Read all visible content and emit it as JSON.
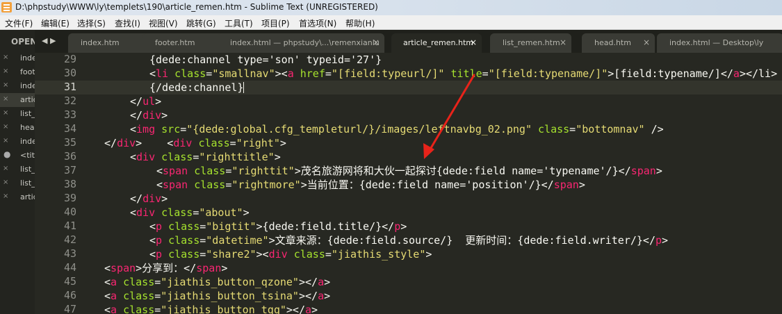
{
  "window": {
    "title": "D:\\phpstudy\\WWW\\ly\\templets\\190\\article_remen.htm - Sublime Text (UNREGISTERED)"
  },
  "menubar": [
    {
      "id": "file",
      "label": "文件(F)"
    },
    {
      "id": "edit",
      "label": "编辑(E)"
    },
    {
      "id": "selection",
      "label": "选择(S)"
    },
    {
      "id": "find",
      "label": "查找(I)"
    },
    {
      "id": "view",
      "label": "视图(V)"
    },
    {
      "id": "goto",
      "label": "跳转(G)"
    },
    {
      "id": "tools",
      "label": "工具(T)"
    },
    {
      "id": "project",
      "label": "项目(P)"
    },
    {
      "id": "preferences",
      "label": "首选项(N)"
    },
    {
      "id": "help",
      "label": "帮助(H)"
    }
  ],
  "sidebar": {
    "header": "OPEN",
    "files": [
      {
        "label": "inde",
        "marker": "×",
        "active": false
      },
      {
        "label": "foot",
        "marker": "×",
        "active": false
      },
      {
        "label": "inde",
        "marker": "×",
        "active": false
      },
      {
        "label": "artic",
        "marker": "×",
        "active": true
      },
      {
        "label": "list_",
        "marker": "×",
        "active": false
      },
      {
        "label": "head",
        "marker": "×",
        "active": false
      },
      {
        "label": "inde",
        "marker": "×",
        "active": false
      },
      {
        "label": "<titl",
        "marker": "●",
        "active": false
      },
      {
        "label": "list_",
        "marker": "×",
        "active": false
      },
      {
        "label": "list_",
        "marker": "×",
        "active": false
      },
      {
        "label": "artic",
        "marker": "×",
        "active": false
      }
    ]
  },
  "tabs": {
    "nav": "◀ ▶",
    "close": "×",
    "items": [
      {
        "label": "index.htm",
        "active": false
      },
      {
        "label": "footer.htm",
        "active": false
      },
      {
        "label": "index.html — phpstudy\\...\\remenxianlu",
        "active": false
      },
      {
        "label": "article_remen.htm",
        "active": true
      },
      {
        "label": "list_remen.htm",
        "active": false
      },
      {
        "label": "head.htm",
        "active": false
      },
      {
        "label": "index.html — Desktop\\ly",
        "active": false
      }
    ]
  },
  "editor": {
    "current_line": 31,
    "accent_colors": {
      "tag": "#f92672",
      "attr": "#a6e22e",
      "string": "#e6db74",
      "text": "#f8f8f2",
      "annotation_arrow": "#e8231a"
    },
    "lines": [
      {
        "n": "29",
        "cls": [
          "p"
        ],
        "text": [
          "{dede:channel type='son' typeid='27'}"
        ]
      },
      {
        "n": "30",
        "cls": [
          "p",
          "t",
          "p",
          "a",
          "p",
          "s",
          "p",
          "t",
          "p",
          "a",
          "p",
          "s",
          "p",
          "a",
          "p",
          "s",
          "p",
          "t",
          "p"
        ],
        "text": [
          "<",
          "li",
          " ",
          "class",
          "=",
          "\"smallnav\"",
          "><",
          "a",
          " ",
          "href",
          "=",
          "\"[field:typeurl/]\"",
          " ",
          "title",
          "=",
          "\"[field:typename/]\"",
          ">[field:typename/]</",
          "a",
          "></li>"
        ]
      },
      {
        "n": "31",
        "cls": [
          "p"
        ],
        "text": [
          "{/dede:channel}"
        ]
      },
      {
        "n": "32",
        "cls": [
          "p",
          "t",
          "p"
        ],
        "text": [
          "</",
          "ul",
          ">"
        ]
      },
      {
        "n": "33",
        "cls": [
          "p",
          "t",
          "p"
        ],
        "text": [
          "</",
          "div",
          ">"
        ]
      },
      {
        "n": "34",
        "cls": [
          "p",
          "t",
          "p",
          "a",
          "p",
          "s",
          "p",
          "a",
          "p",
          "s",
          "p"
        ],
        "text": [
          "<",
          "img",
          " ",
          "src",
          "=",
          "\"{dede:global.cfg_templeturl/}/images/leftnavbg_02.png\"",
          " ",
          "class",
          "=",
          "\"bottomnav\"",
          " />"
        ]
      },
      {
        "n": "35",
        "cls": [
          "p",
          "t",
          "p",
          "t",
          "p",
          "a",
          "p",
          "s",
          "p"
        ],
        "text": [
          "</",
          "div",
          ">    <",
          "div",
          " ",
          "class",
          "=",
          "\"right\"",
          ">"
        ]
      },
      {
        "n": "36",
        "cls": [
          "p",
          "t",
          "p",
          "a",
          "p",
          "s",
          "p"
        ],
        "text": [
          "<",
          "div",
          " ",
          "class",
          "=",
          "\"righttitle\"",
          ">"
        ]
      },
      {
        "n": "37",
        "cls": [
          "p",
          "t",
          "p",
          "a",
          "p",
          "s",
          "p",
          "t",
          "p"
        ],
        "text": [
          "<",
          "span",
          " ",
          "class",
          "=",
          "\"righttit\"",
          ">茂名旅游网将和大伙一起探讨{dede:field name='typename'/}</",
          "span",
          ">"
        ]
      },
      {
        "n": "38",
        "cls": [
          "p",
          "t",
          "p",
          "a",
          "p",
          "s",
          "p",
          "t",
          "p"
        ],
        "text": [
          "<",
          "span",
          " ",
          "class",
          "=",
          "\"rightmore\"",
          ">当前位置：{dede:field name='position'/}</",
          "span",
          ">"
        ]
      },
      {
        "n": "39",
        "cls": [
          "p",
          "t",
          "p"
        ],
        "text": [
          "</",
          "div",
          ">"
        ]
      },
      {
        "n": "40",
        "cls": [
          "p",
          "t",
          "p",
          "a",
          "p",
          "s",
          "p"
        ],
        "text": [
          "<",
          "div",
          " ",
          "class",
          "=",
          "\"about\"",
          ">"
        ]
      },
      {
        "n": "41",
        "cls": [
          "p",
          "t",
          "p",
          "a",
          "p",
          "s",
          "p",
          "t",
          "p"
        ],
        "text": [
          "<",
          "p",
          " ",
          "class",
          "=",
          "\"bigtit\"",
          ">{dede:field.title/}</",
          "p",
          ">"
        ]
      },
      {
        "n": "42",
        "cls": [
          "p",
          "t",
          "p",
          "a",
          "p",
          "s",
          "p",
          "t",
          "p"
        ],
        "text": [
          "<",
          "p",
          " ",
          "class",
          "=",
          "\"datetime\"",
          ">文章来源：{dede:field.source/}  更新时间：{dede:field.writer/}</",
          "p",
          ">"
        ]
      },
      {
        "n": "43",
        "cls": [
          "p",
          "t",
          "p",
          "a",
          "p",
          "s",
          "p",
          "t",
          "p",
          "a",
          "p",
          "s",
          "p"
        ],
        "text": [
          "<",
          "p",
          " ",
          "class",
          "=",
          "\"share2\"",
          "><",
          "div",
          " ",
          "class",
          "=",
          "\"jiathis_style\"",
          ">"
        ]
      },
      {
        "n": "44",
        "cls": [
          "p",
          "t",
          "p",
          "t",
          "p"
        ],
        "text": [
          "<",
          "span",
          ">分享到：</",
          "span",
          ">"
        ]
      },
      {
        "n": "45",
        "cls": [
          "p",
          "t",
          "p",
          "a",
          "p",
          "s",
          "p",
          "t",
          "p"
        ],
        "text": [
          "<",
          "a",
          " ",
          "class",
          "=",
          "\"jiathis_button_qzone\"",
          "></",
          "a",
          ">"
        ]
      },
      {
        "n": "46",
        "cls": [
          "p",
          "t",
          "p",
          "a",
          "p",
          "s",
          "p",
          "t",
          "p"
        ],
        "text": [
          "<",
          "a",
          " ",
          "class",
          "=",
          "\"jiathis_button_tsina\"",
          "></",
          "a",
          ">"
        ]
      },
      {
        "n": "47",
        "cls": [
          "p",
          "t",
          "p",
          "a",
          "p",
          "s",
          "p",
          "t",
          "p"
        ],
        "text": [
          "<",
          "a",
          " ",
          "class",
          "=",
          "\"jiathis_button_tqq\"",
          "></",
          "a",
          ">"
        ]
      }
    ]
  }
}
